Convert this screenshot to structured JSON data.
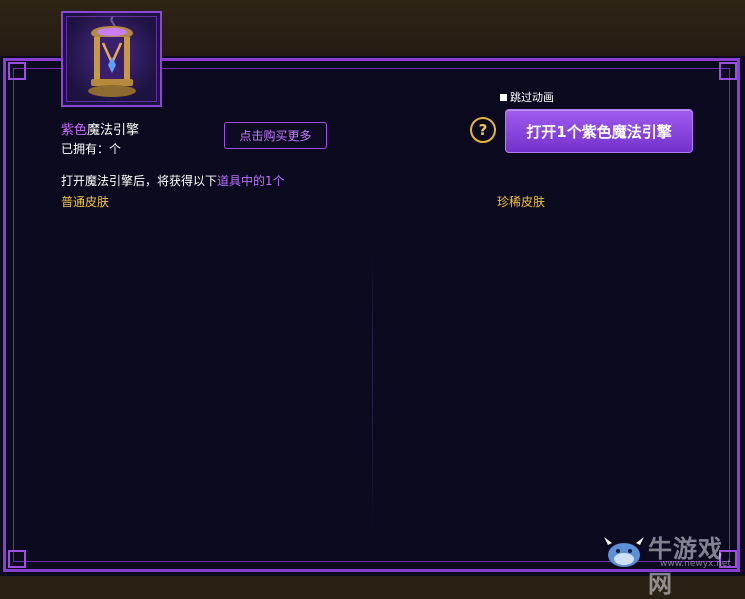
{
  "item": {
    "icon": "magic-lantern-icon",
    "name_colored": "紫色",
    "name_rest": "魔法引擎",
    "owned": "已拥有：个"
  },
  "buttons": {
    "buy_more": "点击购买更多",
    "open": "打开1个紫色魔法引擎",
    "help": "?"
  },
  "skip_animation": {
    "label": "跳过动画"
  },
  "description": {
    "prefix": "打开魔法引擎后，将获得以下",
    "highlight": "道具中的1个"
  },
  "categories": {
    "normal": "普通皮肤",
    "rare": "珍稀皮肤"
  },
  "watermark": {
    "name": "牛游戏网",
    "url": "www.newyx.net"
  },
  "colors": {
    "accent": "#8a3fd1",
    "gold": "#f2c23d",
    "panel": "#0b0a1e"
  }
}
